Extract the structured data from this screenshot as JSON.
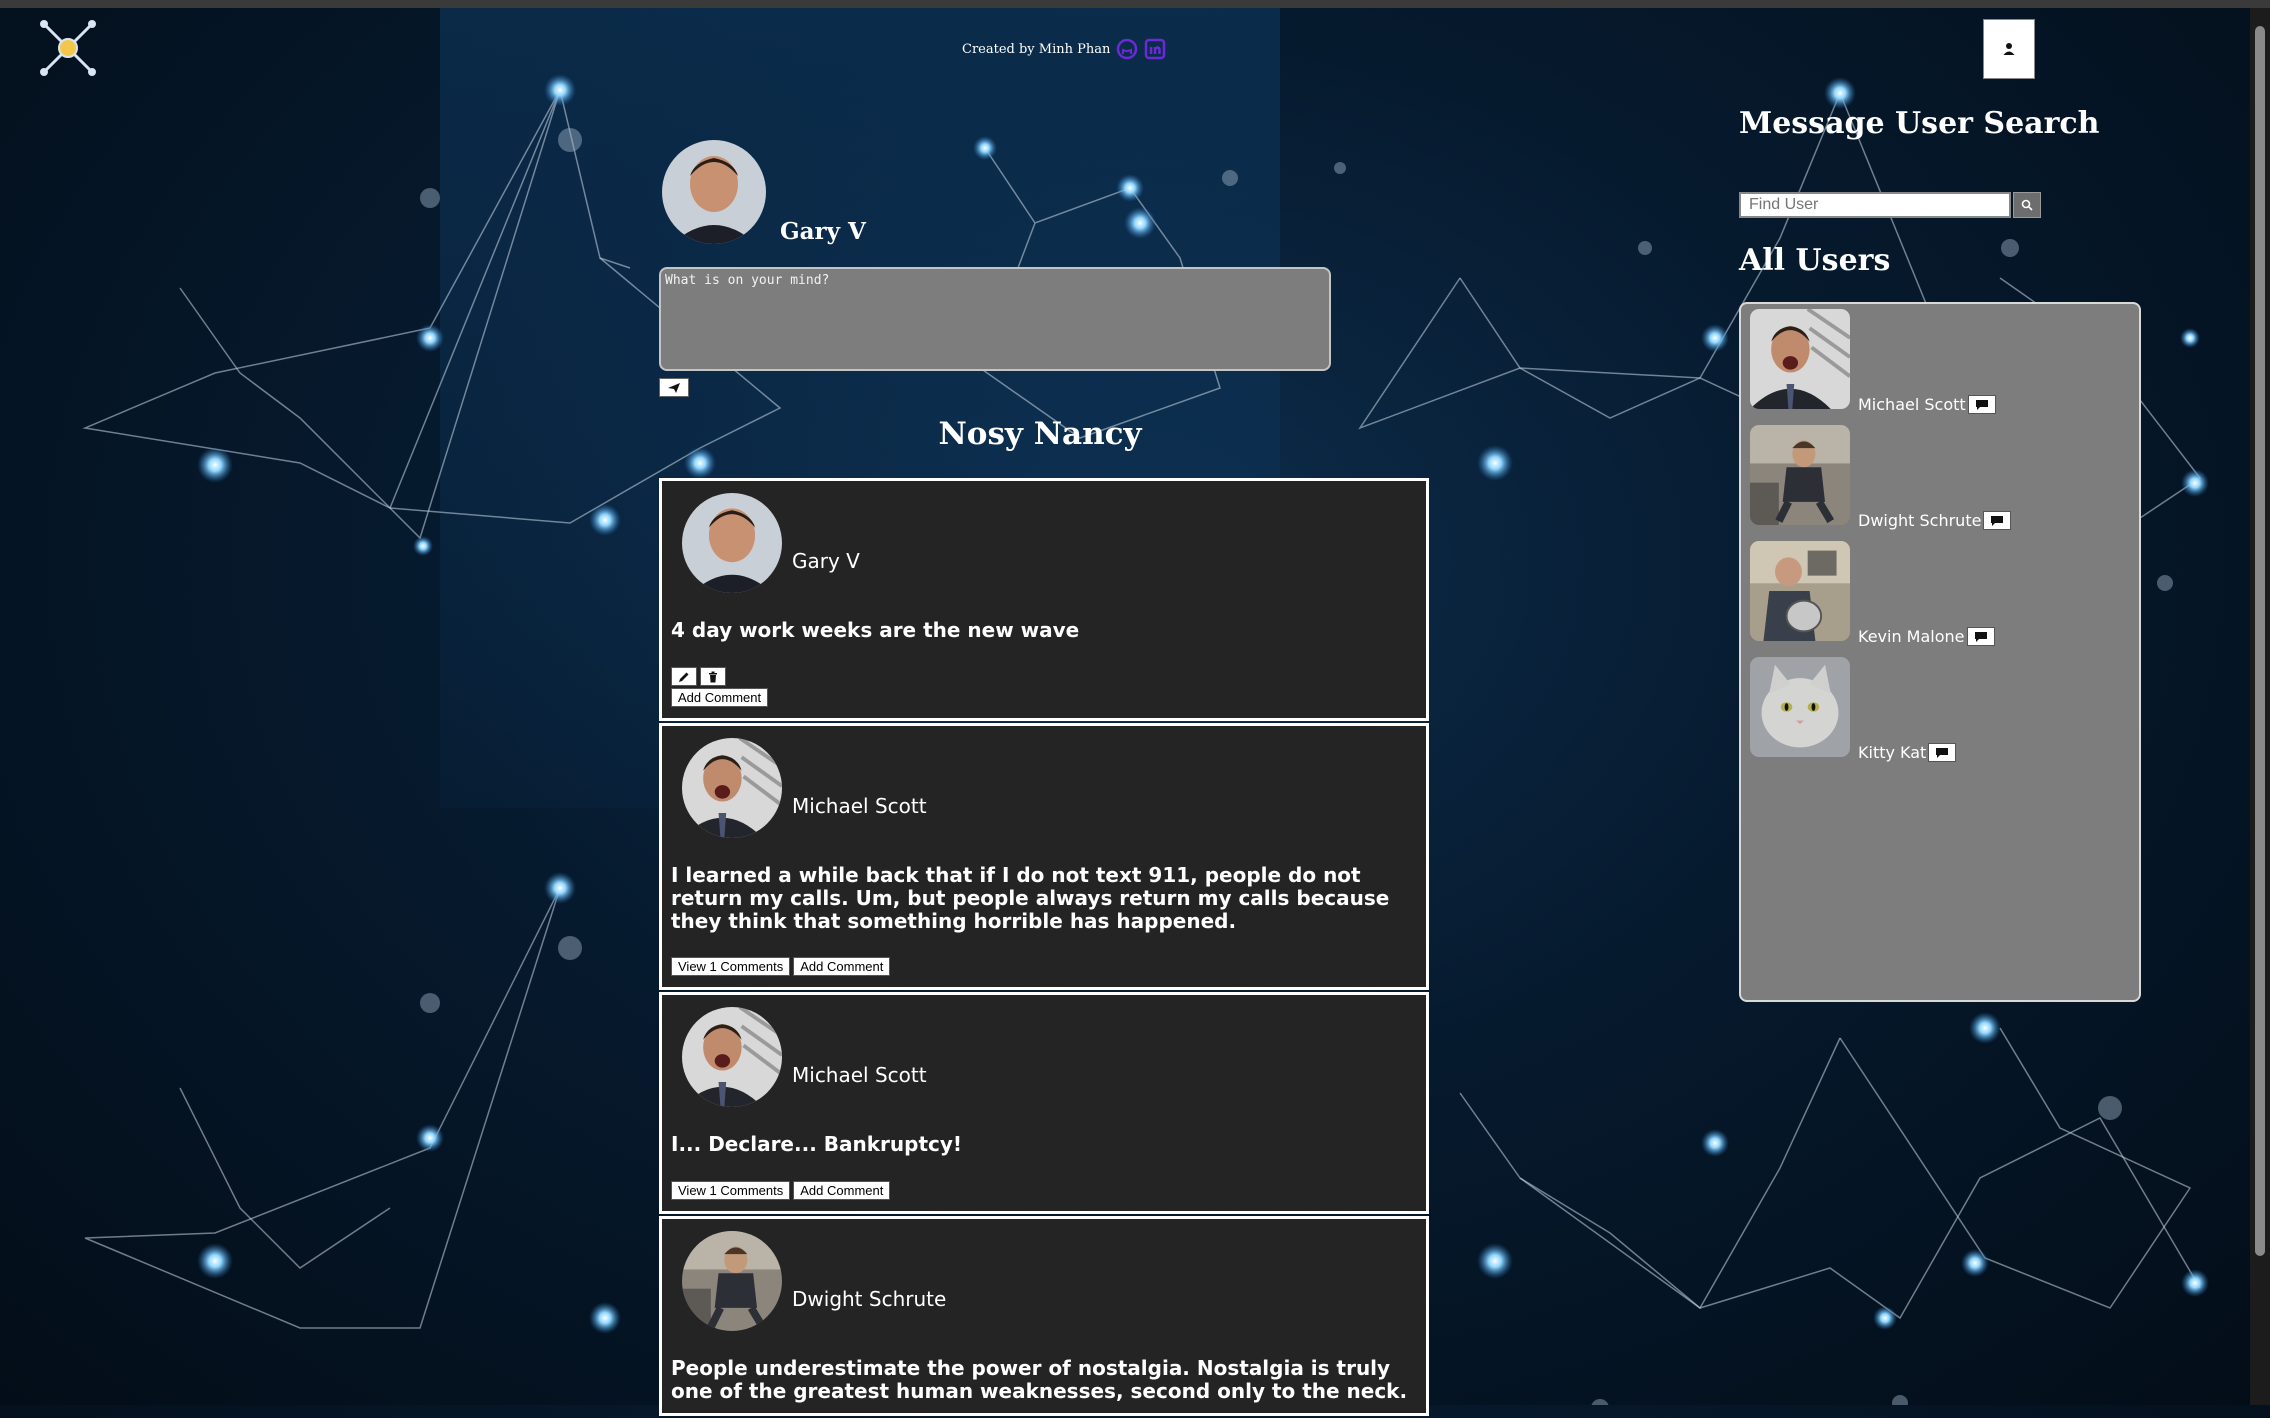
{
  "header": {
    "credit_text": "Created by Minh Phan",
    "github_icon": "github-icon",
    "linkedin_icon": "linkedin-icon",
    "logo_icon": "network-logo-icon",
    "profile_icon": "user-icon"
  },
  "composer": {
    "user_name": "Gary V",
    "placeholder": "What is on your mind?",
    "send_icon": "send-icon"
  },
  "feed": {
    "title": "Nosy Nancy",
    "posts": [
      {
        "author": "Gary V",
        "text": "4 day work weeks are the new wave",
        "edit_icon": "pencil-icon",
        "delete_icon": "trash-icon",
        "add_comment_label": "Add Comment"
      },
      {
        "author": "Michael Scott",
        "text": "I learned a while back that if I do not text 911, people do not return my calls. Um, but people always return my calls because they think that something horrible has happened.",
        "view_comments_label": "View 1 Comments",
        "add_comment_label": "Add Comment"
      },
      {
        "author": "Michael Scott",
        "text": "I... Declare... Bankruptcy!",
        "view_comments_label": "View 1 Comments",
        "add_comment_label": "Add Comment"
      },
      {
        "author": "Dwight Schrute",
        "text": "People underestimate the power of nostalgia. Nostalgia is truly one of the greatest human weaknesses, second only to the neck."
      }
    ]
  },
  "sidebar": {
    "search_title": "Message User Search",
    "search_placeholder": "Find User",
    "search_icon": "search-icon",
    "users_title": "All Users",
    "users": [
      {
        "name": "Michael Scott",
        "icon": "message-icon"
      },
      {
        "name": "Dwight Schrute",
        "icon": "message-icon"
      },
      {
        "name": "Kevin Malone",
        "icon": "message-icon"
      },
      {
        "name": "Kitty Kat",
        "icon": "message-icon"
      }
    ]
  },
  "colors": {
    "background": "#061a2e",
    "card": "#242424",
    "panel": "#7d7d7d",
    "node_glow": "#5fc4ff"
  }
}
